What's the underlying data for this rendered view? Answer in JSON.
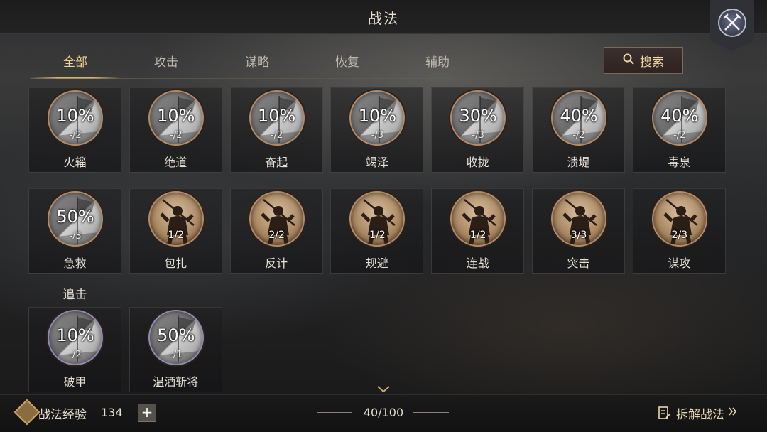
{
  "header": {
    "title": "战法"
  },
  "tabs": [
    {
      "label": "全部",
      "active": true
    },
    {
      "label": "攻击",
      "active": false
    },
    {
      "label": "谋略",
      "active": false
    },
    {
      "label": "恢复",
      "active": false
    },
    {
      "label": "辅助",
      "active": false
    }
  ],
  "search": {
    "label": "搜索"
  },
  "skills": [
    {
      "name": "火辎",
      "percent": "10%",
      "sub": "-/2",
      "style": "grey"
    },
    {
      "name": "绝道",
      "percent": "10%",
      "sub": "-/2",
      "style": "grey"
    },
    {
      "name": "奋起",
      "percent": "10%",
      "sub": "-/2",
      "style": "grey"
    },
    {
      "name": "竭泽",
      "percent": "10%",
      "sub": "-/3",
      "style": "grey"
    },
    {
      "name": "收拢",
      "percent": "30%",
      "sub": "-/3",
      "style": "grey"
    },
    {
      "name": "溃堤",
      "percent": "40%",
      "sub": "-/2",
      "style": "grey"
    },
    {
      "name": "毒泉",
      "percent": "40%",
      "sub": "-/2",
      "style": "grey"
    },
    {
      "name": "急救",
      "percent": "50%",
      "sub": "-/3",
      "style": "grey"
    },
    {
      "name": "包扎",
      "count": "1/2",
      "style": "bronze"
    },
    {
      "name": "反计",
      "count": "2/2",
      "style": "bronze"
    },
    {
      "name": "规避",
      "count": "1/2",
      "style": "bronze"
    },
    {
      "name": "连战",
      "count": "1/2",
      "style": "bronze"
    },
    {
      "name": "突击",
      "count": "3/3",
      "style": "bronze"
    },
    {
      "name": "谋攻",
      "count": "2/3",
      "style": "bronze"
    }
  ],
  "section_pursuit": {
    "title": "追击",
    "skills": [
      {
        "name": "破甲",
        "percent": "10%",
        "sub": "-/2",
        "style": "grey-purple"
      },
      {
        "name": "温酒斩将",
        "percent": "50%",
        "sub": "-/1",
        "style": "grey-purple"
      }
    ]
  },
  "footer": {
    "exp_label": "战法经验",
    "exp_value": "134",
    "plus": "+",
    "capacity": "40/100",
    "dismantle_label": "拆解战法"
  },
  "colors": {
    "accent_gold": "#d6b26a",
    "tab_active": "#f0d38a",
    "bronze_ring": "#b48a66",
    "purple_ring": "#8f88b6"
  },
  "icons": {
    "close": "crossed-swords-icon",
    "search": "search-icon",
    "exp": "exp-badge-icon",
    "dismantle": "document-edit-icon",
    "more": "chevron-down-icon"
  }
}
